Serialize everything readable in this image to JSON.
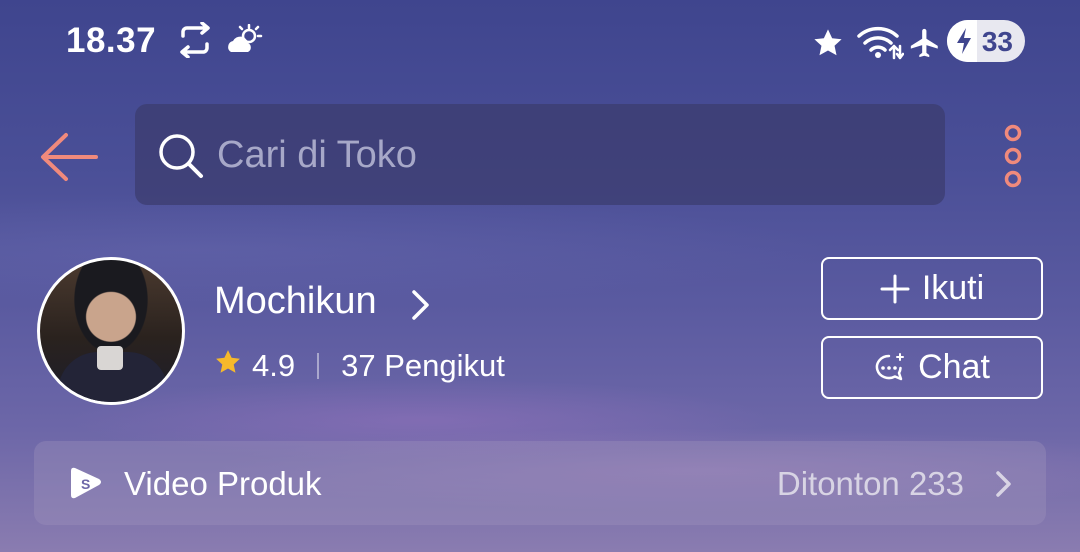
{
  "status_bar": {
    "time": "18.37",
    "battery": "33",
    "icons": [
      "sync-icon",
      "weather-icon",
      "star-icon",
      "wifi-icon",
      "airplane-icon",
      "battery-icon"
    ]
  },
  "header": {
    "search_placeholder": "Cari di Toko",
    "back_icon": "back-arrow-icon",
    "more_icon": "more-vertical-icon",
    "accent_color": "#f08a7c"
  },
  "shop": {
    "name": "Mochikun",
    "rating": "4.9",
    "followers": "37 Pengikut",
    "follow_label": "Ikuti",
    "chat_label": "Chat"
  },
  "video_bar": {
    "label": "Video Produk",
    "views": "Ditonton 233"
  }
}
